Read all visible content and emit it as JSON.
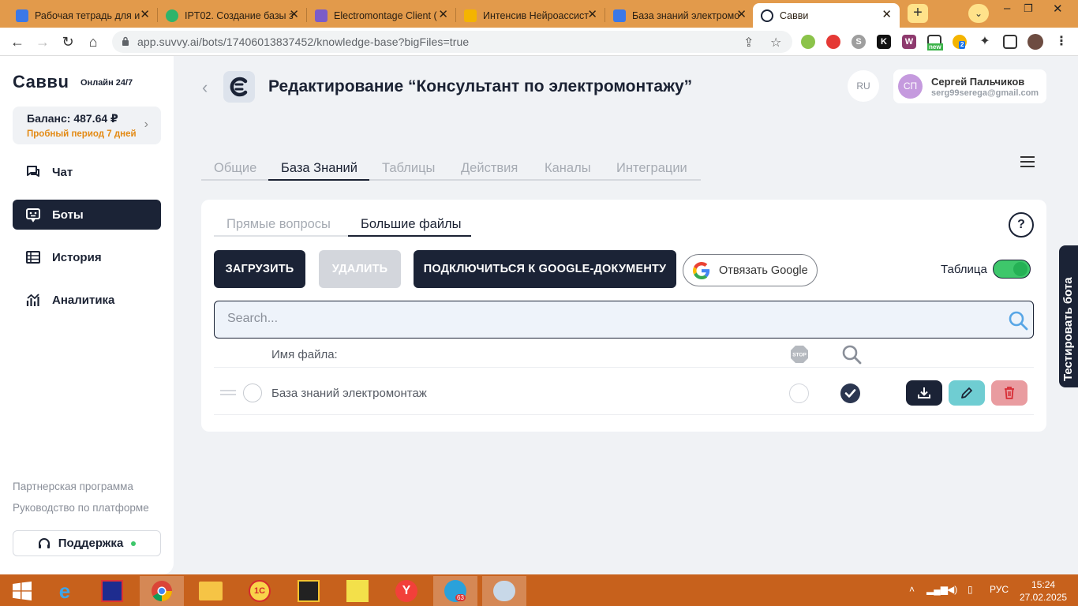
{
  "browser": {
    "tabs": [
      {
        "title": "Рабочая тетрадь для и",
        "favicon_color": "#3b78e7"
      },
      {
        "title": "IPT02. Создание базы з",
        "favicon_color": "#2fb46b"
      },
      {
        "title": "Electromontage Client (",
        "favicon_color": "#7b5cc9"
      },
      {
        "title": "Интенсив Нейроассист",
        "favicon_color": "#f4b400"
      },
      {
        "title": "База знаний электромо",
        "favicon_color": "#3b78e7"
      },
      {
        "title": "Савви",
        "favicon_color": "#1b2336"
      }
    ],
    "url": "app.suvvy.ai/bots/17406013837452/knowledge-base?bigFiles=true",
    "ext_badge_count": "2",
    "ext_new_label": "new"
  },
  "sidebar": {
    "logo": "Саввu",
    "logo_subtitle": "Онлайн 24/7",
    "balance_label": "Баланс: 487.64 ₽",
    "trial_label": "Пробный период 7 дней",
    "items": [
      {
        "label": "Чат",
        "icon": "chat-icon"
      },
      {
        "label": "Боты",
        "icon": "bot-icon",
        "active": true
      },
      {
        "label": "История",
        "icon": "history-icon"
      },
      {
        "label": "Аналитика",
        "icon": "analytics-icon"
      }
    ],
    "links": [
      "Партнерская программа",
      "Руководство по платформе"
    ],
    "support_label": "Поддержка"
  },
  "header": {
    "title": "Редактирование “Консультант по электромонтажу”",
    "lang": "RU",
    "user_initials": "СП",
    "user_name": "Сергей Пальчиков",
    "user_email": "serg99serega@gmail.com"
  },
  "main_tabs": [
    "Общие",
    "База Знаний",
    "Таблицы",
    "Действия",
    "Каналы",
    "Интеграции"
  ],
  "active_main_tab": "База Знаний",
  "sub_tabs": [
    "Прямые вопросы",
    "Большие файлы"
  ],
  "active_sub_tab": "Большие файлы",
  "actions": {
    "upload": "ЗАГРУЗИТЬ",
    "delete": "УДАЛИТЬ",
    "connect_google": "ПОДКЛЮЧИТЬСЯ К GOOGLE-ДОКУМЕНТУ",
    "unlink_google": "Отвязать Google",
    "table_toggle_label": "Таблица",
    "table_toggle_on": true,
    "help": "?"
  },
  "search": {
    "placeholder": "Search...",
    "value": ""
  },
  "file_table": {
    "column_name": "Имя файла:",
    "stop_icon_text": "STOP",
    "rows": [
      {
        "name": "База знаний электромонтаж",
        "stop": false,
        "search": true
      }
    ]
  },
  "test_bot_label": "Тестировать бота",
  "taskbar": {
    "lang": "РУС",
    "time": "15:24",
    "date": "27.02.2025",
    "telegram_badge": "63"
  },
  "colors": {
    "accent": "#1b2336",
    "toggle": "#3ec76b",
    "trial": "#e38a14"
  }
}
